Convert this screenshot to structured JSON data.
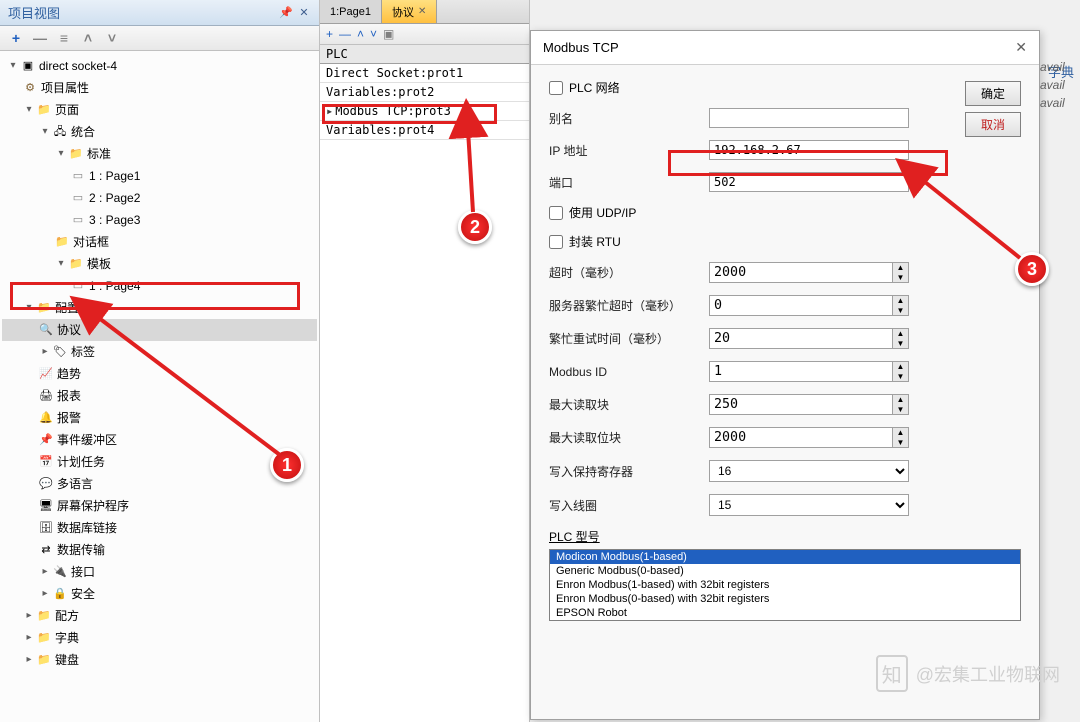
{
  "leftPanel": {
    "title": "项目视图",
    "toolbar": {
      "add": "+",
      "remove": "—"
    }
  },
  "tree": {
    "root": "direct socket-4",
    "projectProps": "项目属性",
    "pages": "页面",
    "unified": "统合",
    "standard": "标准",
    "page1": "1 : Page1",
    "page2": "2 : Page2",
    "page3": "3 : Page3",
    "dialog": "对话框",
    "template": "模板",
    "page4": "1 : Page4",
    "config": "配置",
    "protocol": "协议",
    "tags": "标签",
    "trend": "趋势",
    "report": "报表",
    "alarm": "报警",
    "eventBuffer": "事件缓冲区",
    "schedule": "计划任务",
    "multilang": "多语言",
    "screensaver": "屏幕保护程序",
    "dblink": "数据库链接",
    "datatransfer": "数据传输",
    "interface": "接口",
    "security": "安全",
    "recipe": "配方",
    "dictionary": "字典",
    "keyboard": "键盘"
  },
  "tabs": {
    "tab1": "1:Page1",
    "tab2": "协议"
  },
  "plc": {
    "header": "PLC",
    "item1": "Direct Socket:prot1",
    "item2": "Variables:prot2",
    "item3": "Modbus TCP:prot3",
    "item4": "Variables:prot4"
  },
  "dialog": {
    "title": "Modbus TCP",
    "plcNetwork": "PLC 网络",
    "alias": "别名",
    "aliasVal": "",
    "ip": "IP 地址",
    "ipVal": "192.168.2.67",
    "port": "端口",
    "portVal": "502",
    "udp": "使用 UDP/IP",
    "rtu": "封装 RTU",
    "timeout": "超时（毫秒）",
    "timeoutVal": "2000",
    "busyTimeout": "服务器繁忙超时（毫秒）",
    "busyTimeoutVal": "0",
    "retryTime": "繁忙重试时间（毫秒）",
    "retryTimeVal": "20",
    "modbusId": "Modbus ID",
    "modbusIdVal": "1",
    "maxReadBlock": "最大读取块",
    "maxReadBlockVal": "250",
    "maxReadBit": "最大读取位块",
    "maxReadBitVal": "2000",
    "writeHold": "写入保持寄存器",
    "writeHoldVal": "16",
    "writeCoil": "写入线圈",
    "writeCoilVal": "15",
    "plcModel": "PLC 型号",
    "model1": "Modicon Modbus(1-based)",
    "model2": "Generic Modbus(0-based)",
    "model3": "Enron Modbus(1-based) with 32bit registers",
    "model4": "Enron Modbus(0-based) with 32bit registers",
    "model5": "EPSON Robot",
    "ok": "确定",
    "cancel": "取消"
  },
  "rightEdge": {
    "zd": "字典",
    "avail": "avail"
  },
  "watermark": {
    "text": "@宏集工业物联网",
    "icon": "知"
  }
}
